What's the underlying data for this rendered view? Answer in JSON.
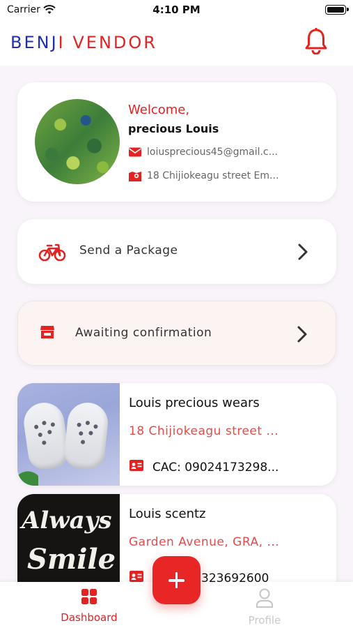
{
  "status_bar": {
    "carrier": "Carrier",
    "time": "4:10 PM"
  },
  "header": {
    "brand_part1": "BENJ",
    "brand_part2": "I VENDOR",
    "bell_icon": "bell-icon"
  },
  "profile": {
    "welcome": "Welcome,",
    "name": "precious  Louis",
    "email": "loiusprecious45@gmail.c...",
    "address": "18 Chijiokeagu street Em..."
  },
  "actions": [
    {
      "label": "Send a Package",
      "icon": "bicycle-icon"
    },
    {
      "label": "Awaiting confirmation",
      "icon": "store-icon"
    }
  ],
  "stores": [
    {
      "name": "Louis precious wears",
      "address": "18 Chijiokeagu street ...",
      "cac": "CAC: 09024173298..."
    },
    {
      "name": "Louis scentz",
      "address": "Garden Avenue, GRA, ...",
      "cac": "323692600",
      "image_text_1": "Always",
      "image_text_2": "Smile"
    }
  ],
  "bottom_nav": {
    "dashboard": "Dashboard",
    "profile": "Profile"
  },
  "colors": {
    "accent": "#e32222",
    "brand_blue": "#1f2fb0",
    "background": "#f8f4fa"
  }
}
